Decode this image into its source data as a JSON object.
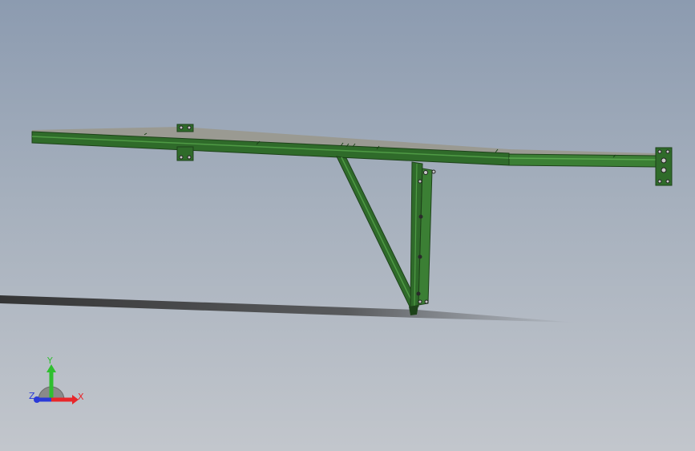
{
  "viewport": {
    "background_top": "#8c9bb0",
    "background_bottom": "#c2c6cc"
  },
  "model": {
    "frame_color": "#2f6b2a",
    "frame_highlight": "#4f9a45",
    "frame_shadow": "#1d4219",
    "top_surface_color": "#9a9a92",
    "shadow_color": "#3a3a3a"
  },
  "triad": {
    "x_label": "X",
    "y_label": "Y",
    "z_label": "Z",
    "x_color": "#e8262a",
    "y_color": "#2fbf2f",
    "z_color": "#2a3ad8"
  }
}
